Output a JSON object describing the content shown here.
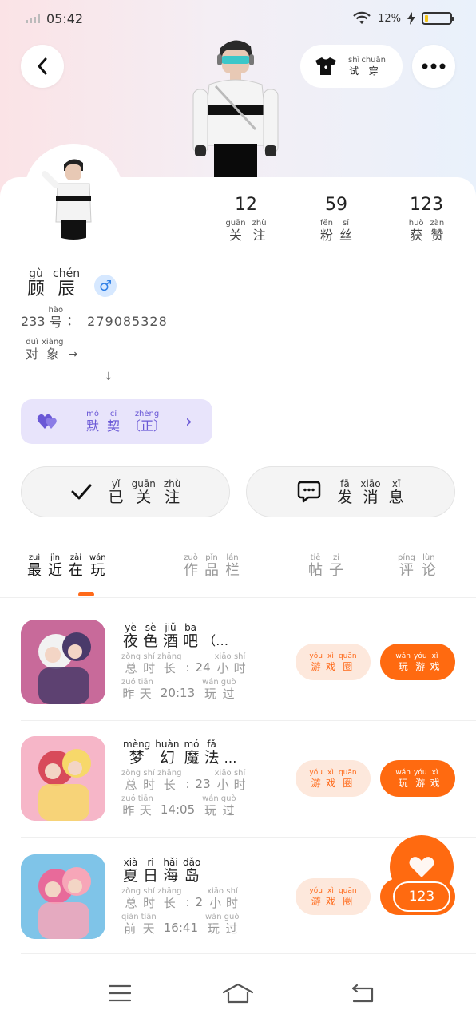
{
  "status_bar": {
    "time": "05:42",
    "battery_pct": "12%",
    "battery_level": 0.12
  },
  "header": {
    "back_icon": "chevron-left-icon",
    "tryon": {
      "py": [
        "shì",
        "chuān"
      ],
      "hz": [
        "试",
        "穿"
      ],
      "icon": "tshirt-icon"
    },
    "more_icon": "more-dots-icon"
  },
  "stats": [
    {
      "value": "12",
      "py": [
        "guān",
        "zhù"
      ],
      "hz": [
        "关",
        "注"
      ]
    },
    {
      "value": "59",
      "py": [
        "fěn",
        "sī"
      ],
      "hz": [
        "粉",
        "丝"
      ]
    },
    {
      "value": "123",
      "py": [
        "huò",
        "zàn"
      ],
      "hz": [
        "获",
        "赞"
      ]
    }
  ],
  "profile": {
    "name_py": [
      "gù",
      "chén"
    ],
    "name_hz": [
      "顾",
      "辰"
    ],
    "gender_symbol": "♂",
    "id_prefix": "233",
    "id_py": "hào",
    "id_hz": "号",
    "id_colon": "：",
    "id_value": "279085328",
    "partner_py": [
      "duì",
      "xiàng"
    ],
    "partner_hz": [
      "对",
      "象"
    ],
    "partner_arrow": "→",
    "down_arrow": "↓"
  },
  "mo_ci": {
    "py": [
      "mò",
      "cí",
      "zhèng"
    ],
    "hz": [
      "默",
      "契",
      "〔正〕"
    ],
    "chevron": "›"
  },
  "actions": {
    "followed": {
      "py": [
        "yǐ",
        "guān",
        "zhù"
      ],
      "hz": [
        "已",
        "关",
        "注"
      ],
      "icon": "check-icon"
    },
    "message": {
      "py": [
        "fā",
        "xiāo",
        "xī"
      ],
      "hz": [
        "发",
        "消",
        "息"
      ],
      "icon": "chat-bubble-icon"
    }
  },
  "tabs": [
    {
      "py": [
        "zuì",
        "jìn",
        "zài",
        "wán"
      ],
      "hz": [
        "最",
        "近",
        "在",
        "玩"
      ],
      "active": true
    },
    {
      "py": [
        "zuò",
        "pǐn",
        "lán"
      ],
      "hz": [
        "作",
        "品",
        "栏"
      ],
      "active": false
    },
    {
      "py": [
        "tiē",
        "zi"
      ],
      "hz": [
        "帖",
        "子"
      ],
      "active": false
    },
    {
      "py": [
        "píng",
        "lùn"
      ],
      "hz": [
        "评",
        "论"
      ],
      "active": false
    }
  ],
  "games": [
    {
      "title_py": [
        "yè",
        "sè",
        "jiǔ",
        "ba"
      ],
      "title_hz": [
        "夜",
        "色",
        "酒",
        "吧"
      ],
      "title_suffix": "（…",
      "duration_label_py": [
        "zǒng",
        "shí",
        "zhǎng"
      ],
      "duration_label_hz": [
        "总",
        "时",
        "长"
      ],
      "duration_value": "24",
      "unit_py": [
        "xiǎo",
        "shí"
      ],
      "unit_hz": [
        "小",
        "时"
      ],
      "when_py": [
        "zuó",
        "tiān"
      ],
      "when_hz": [
        "昨",
        "天"
      ],
      "time": "20:13",
      "played_py": [
        "wán",
        "guò"
      ],
      "played_hz": [
        "玩",
        "过"
      ]
    },
    {
      "title_py": [
        "mèng",
        "huàn",
        "mó",
        "fǎ"
      ],
      "title_hz": [
        "梦",
        "幻",
        "魔",
        "法"
      ],
      "title_suffix": "…",
      "duration_label_py": [
        "zǒng",
        "shí",
        "zhǎng"
      ],
      "duration_label_hz": [
        "总",
        "时",
        "长"
      ],
      "duration_value": "23",
      "unit_py": [
        "xiǎo",
        "shí"
      ],
      "unit_hz": [
        "小",
        "时"
      ],
      "when_py": [
        "zuó",
        "tiān"
      ],
      "when_hz": [
        "昨",
        "天"
      ],
      "time": "14:05",
      "played_py": [
        "wán",
        "guò"
      ],
      "played_hz": [
        "玩",
        "过"
      ]
    },
    {
      "title_py": [
        "xià",
        "rì",
        "hǎi",
        "dǎo"
      ],
      "title_hz": [
        "夏",
        "日",
        "海",
        "岛"
      ],
      "title_suffix": "",
      "duration_label_py": [
        "zǒng",
        "shí",
        "zhǎng"
      ],
      "duration_label_hz": [
        "总",
        "时",
        "长"
      ],
      "duration_value": "2",
      "unit_py": [
        "xiǎo",
        "shí"
      ],
      "unit_hz": [
        "小",
        "时"
      ],
      "when_py": [
        "qián",
        "tiān"
      ],
      "when_hz": [
        "前",
        "天"
      ],
      "time": "16:41",
      "played_py": [
        "wán",
        "guò"
      ],
      "played_hz": [
        "玩",
        "过"
      ]
    }
  ],
  "game_buttons": {
    "circle": {
      "py": [
        "yóu",
        "xì",
        "quān"
      ],
      "hz": [
        "游",
        "戏",
        "圈"
      ]
    },
    "play": {
      "py": [
        "wán",
        "yóu",
        "xì"
      ],
      "hz": [
        "玩",
        "游",
        "戏"
      ]
    }
  },
  "like_bubble": {
    "count": "123",
    "icon": "heart-icon"
  },
  "nav": {
    "menu_icon": "menu-icon",
    "home_icon": "home-icon",
    "back_icon": "back-icon"
  },
  "colors": {
    "accent": "#ff6a10",
    "mo_ci_bg": "#e8e4fb",
    "mo_ci_text": "#6a58d6",
    "gender": "#2f7fe6"
  }
}
